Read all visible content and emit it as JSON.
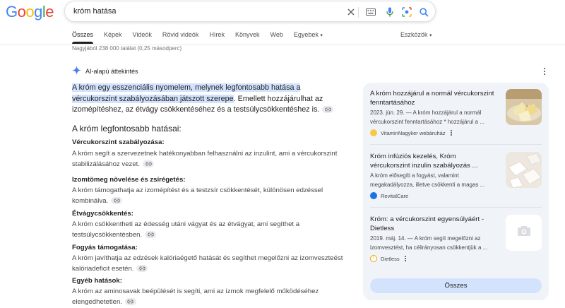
{
  "logo": {
    "letters": [
      "G",
      "o",
      "o",
      "g",
      "l",
      "e"
    ],
    "colors": [
      "#4285F4",
      "#EA4335",
      "#FBBC05",
      "#4285F4",
      "#34A853",
      "#EA4335"
    ]
  },
  "search": {
    "query": "króm hatása"
  },
  "tabs": [
    "Összes",
    "Képek",
    "Videók",
    "Rövid videók",
    "Hírek",
    "Könyvek",
    "Web",
    "Egyebek"
  ],
  "tools_label": "Eszközök",
  "result_stats": "Nagyjából 238 000 találat (0,25 másodperc)",
  "ai": {
    "label": "AI-alapú áttekintés",
    "intro_highlight": "A króm egy esszenciális nyomelem, melynek legfontosabb hatása a vércukorszint szabályozásában játszott szerepe",
    "intro_rest": ". Emellett hozzájárulhat az izomépítéshez, az étvágy csökkentéséhez és a testsúlycsökkentéshez is.",
    "heading": "A króm legfontosabb hatásai:",
    "sections": [
      {
        "title": "Vércukorszint szabályozása:",
        "text": "A króm segít a szervezetnek hatékonyabban felhasználni az inzulint, ami a vércukorszint stabilizálásához vezet."
      },
      {
        "title": "Izomtömeg növelése és zsírégetés:",
        "text": "A króm támogathatja az izomépítést és a testzsír csökkentését, különösen edzéssel kombinálva."
      },
      {
        "title": "Étvágycsökkentés:",
        "text": "A króm csökkentheti az édesség utáni vágyat és az étvágyat, ami segíthet a testsúlycsökkentésben."
      },
      {
        "title": "Fogyás támogatása:",
        "text": "A króm javíthatja az edzések kalóriaégető hatását és segíthet megelőzni az izomveszteést kalóriadeficit esetén."
      },
      {
        "title": "Egyéb hatások:",
        "text": "A króm az aminosavak beépülését is segíti, ami az izmok megfelelő működéséhez elengedhetetlen."
      }
    ]
  },
  "sources": [
    {
      "title": "A króm hozzájárul a normál vércukorszint fenntartásához",
      "desc": "2023. jún. 29. — A króm hozzájárul a normál vércukorszint fenntartásához * hozzájárul a ...",
      "site": "VitaminNagyker webáruház"
    },
    {
      "title": "Króm infúziós kezelés, Króm vércukorszint inzulin szabályozás ...",
      "desc": "A króm elősegíti a fogyást, valamint megakadályozza, illetve csökkenti a magas ...",
      "site": "RevitalCare"
    },
    {
      "title": "Króm: a vércukorszint egyensúlyáért - Dietless",
      "desc": "2019. máj. 14. — A króm segít megelőzni az izomvesztést, ha célirányosan csökkentjük a ...",
      "site": "Dietless"
    }
  ],
  "all_button": "Összes"
}
